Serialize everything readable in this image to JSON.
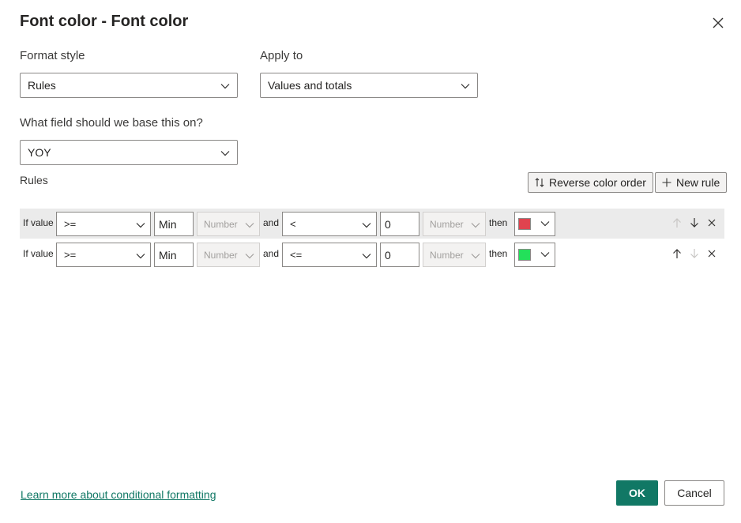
{
  "dialog": {
    "title": "Font color - Font color",
    "close_icon": "close-icon"
  },
  "format_style": {
    "label": "Format style",
    "value": "Rules"
  },
  "apply_to": {
    "label": "Apply to",
    "value": "Values and totals"
  },
  "base_field": {
    "label": "What field should we base this on?",
    "value": "YOY"
  },
  "rules_section": {
    "label": "Rules",
    "reverse_label": "Reverse color order",
    "new_rule_label": "New rule"
  },
  "rules": [
    {
      "if_label": "If value",
      "op1": ">=",
      "val1": "Min",
      "type1": "Number",
      "and_label": "and",
      "op2": "<",
      "val2": "0",
      "type2": "Number",
      "then_label": "then",
      "color": "#e0434f"
    },
    {
      "if_label": "If value",
      "op1": ">=",
      "val1": "Min",
      "type1": "Number",
      "and_label": "and",
      "op2": "<=",
      "val2": "0",
      "type2": "Number",
      "then_label": "then",
      "color": "#23e05a"
    }
  ],
  "footer": {
    "learn_more": "Learn more about conditional formatting",
    "ok_label": "OK",
    "cancel_label": "Cancel"
  },
  "colors": {
    "accent": "#117865"
  }
}
